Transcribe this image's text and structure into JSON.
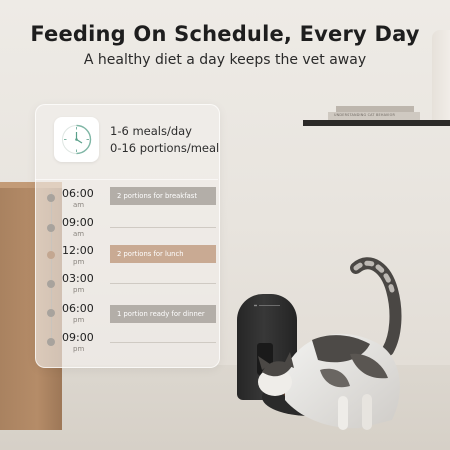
{
  "header": {
    "title": "Feeding On Schedule, Every Day",
    "subtitle": "A healthy diet a day keeps the vet away"
  },
  "scene": {
    "book_label": "UNDERSTANDING CAT BEHAVIOR",
    "colors": {
      "accent_brown": "#c9aa93",
      "chip_gray": "#b3aea8",
      "feeder_black": "#2a2a2a"
    }
  },
  "panel": {
    "icon": "clock-icon",
    "stats": {
      "meals": "1-6 meals/day",
      "portions": "0-16 portions/meal"
    },
    "schedule": [
      {
        "time": "06:00",
        "period": "am",
        "note": "2 portions for breakfast"
      },
      {
        "time": "09:00",
        "period": "am",
        "note": ""
      },
      {
        "time": "12:00",
        "period": "pm",
        "note": "2 portions for lunch"
      },
      {
        "time": "03:00",
        "period": "pm",
        "note": ""
      },
      {
        "time": "06:00",
        "period": "pm",
        "note": "1 portion ready for dinner"
      },
      {
        "time": "09:00",
        "period": "pm",
        "note": ""
      }
    ]
  }
}
